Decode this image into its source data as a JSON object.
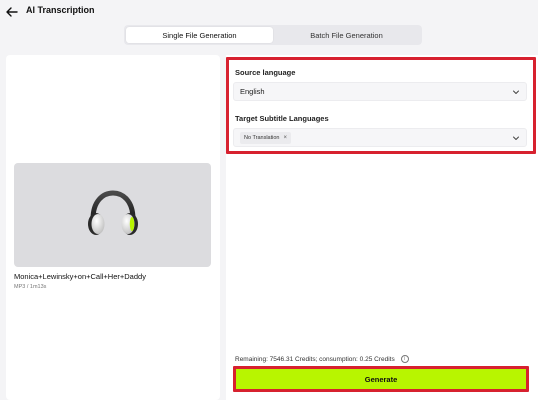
{
  "header": {
    "title": "AI Transcription",
    "back_icon": "arrow-left-icon"
  },
  "tabs": [
    {
      "label": "Single File Generation",
      "active": true
    },
    {
      "label": "Batch File Generation",
      "active": false
    }
  ],
  "file": {
    "name": "Monica+Lewinsky+on+Call+Her+Daddy",
    "meta": "MP3 / 1m13s",
    "thumbnail_icon": "headphones-icon"
  },
  "settings": {
    "source_language_label": "Source language",
    "source_language_value": "English",
    "target_label": "Target Subtitle Languages",
    "target_chip": "No Translation",
    "chip_remove": "×"
  },
  "footer": {
    "credits_text": "Remaining: 7546.31 Credits; consumption: 0.25 Credits",
    "info_icon_glyph": "i",
    "generate_label": "Generate"
  },
  "colors": {
    "accent_green": "#b8f500",
    "highlight_red": "#d7212f"
  }
}
